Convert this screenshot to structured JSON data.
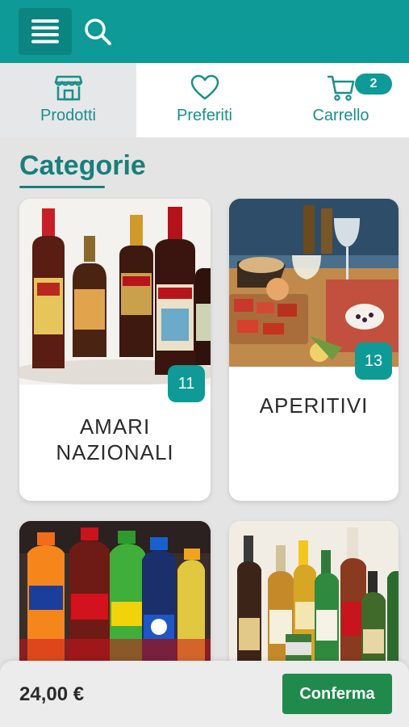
{
  "header": {
    "icons": [
      "hamburger-menu-icon",
      "search-icon"
    ],
    "color": "#0e9a96"
  },
  "tabs": [
    {
      "label": "Prodotti",
      "icon": "store-icon",
      "active": true
    },
    {
      "label": "Preferiti",
      "icon": "heart-icon",
      "active": false
    },
    {
      "label": "Carrello",
      "icon": "cart-icon",
      "active": false,
      "badge": "2"
    }
  ],
  "section": {
    "title": "Categorie"
  },
  "categories": [
    {
      "name_line1": "AMARI",
      "name_line2": "NAZIONALI",
      "count": "11",
      "image": "amaro-bottles"
    },
    {
      "name_line1": "APERITIVI",
      "name_line2": "",
      "count": "13",
      "image": "aperitivo-table"
    },
    {
      "name_line1": "",
      "name_line2": "",
      "count": "",
      "image": "soft-drinks"
    },
    {
      "name_line1": "",
      "name_line2": "",
      "count": "",
      "image": "beer-bottles"
    }
  ],
  "footer": {
    "total": "24,00 €",
    "confirm_label": "Conferma"
  },
  "colors": {
    "accent": "#0e9a96",
    "confirm": "#1f8a4c",
    "title": "#1a7f7b"
  }
}
